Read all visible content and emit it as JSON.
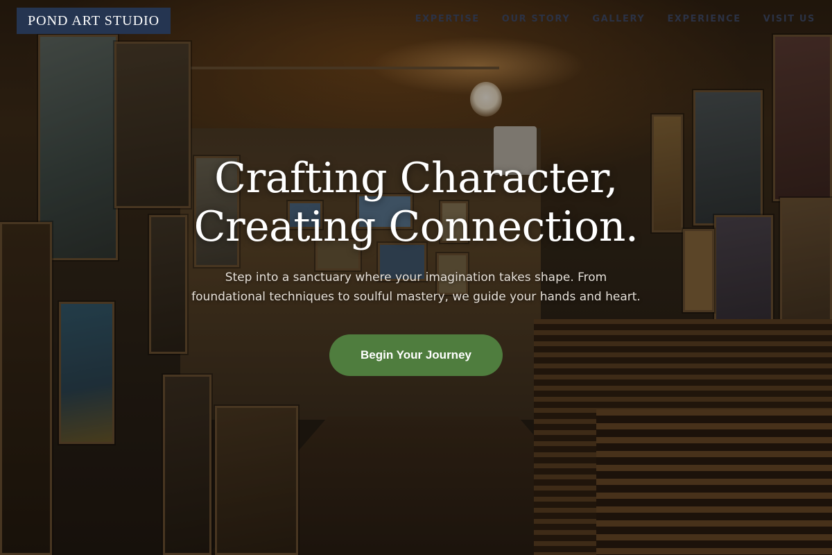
{
  "brand": {
    "name": "POND ART STUDIO"
  },
  "nav": {
    "links": [
      {
        "label": "EXPERTISE"
      },
      {
        "label": "OUR STORY"
      },
      {
        "label": "GALLERY"
      },
      {
        "label": "EXPERIENCE"
      },
      {
        "label": "VISIT US"
      }
    ]
  },
  "hero": {
    "title_line1": "Crafting Character,",
    "title_line2": "Creating Connection.",
    "subtitle": "Step into a sanctuary where your imagination takes shape. From foundational techniques to soulful mastery, we guide your hands and heart.",
    "cta_label": "Begin Your Journey"
  },
  "colors": {
    "logo_bg": "#253551",
    "cta_bg": "#4f7d3e",
    "nav_text": "#2b3245"
  }
}
